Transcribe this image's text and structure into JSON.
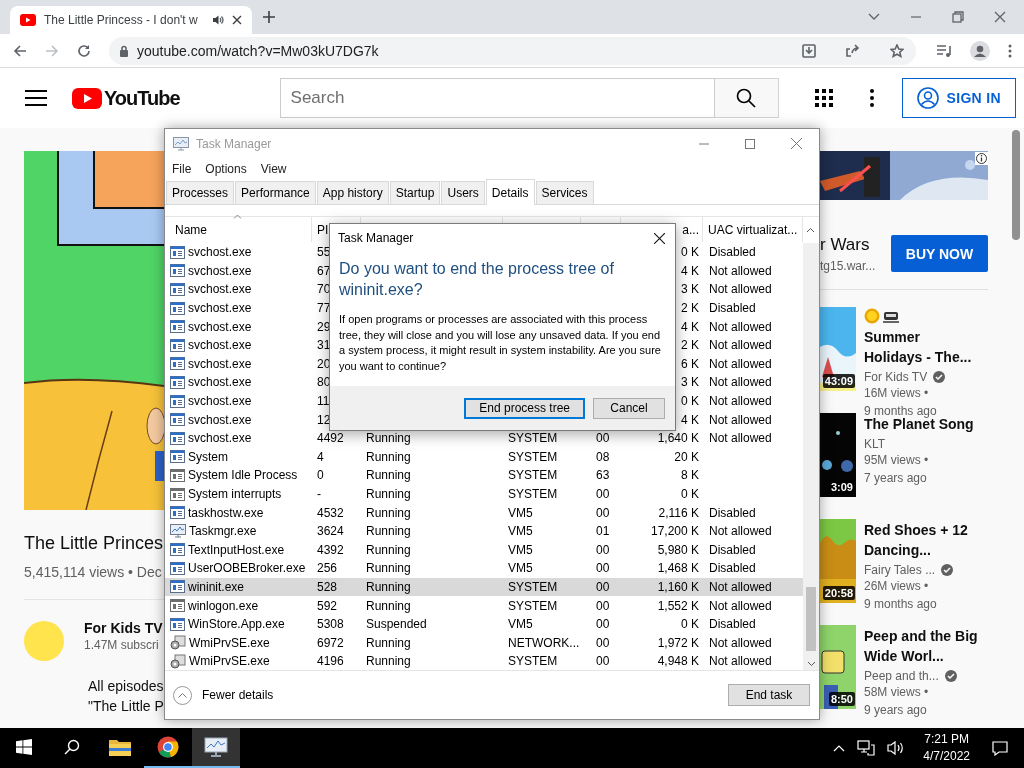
{
  "browser": {
    "tab": {
      "title": "The Little Princess - I don't w",
      "selected": true
    },
    "address": "youtube.com/watch?v=Mw03kU7DG7k"
  },
  "youtube": {
    "logo": "YouTube",
    "search": {
      "placeholder": "Search"
    },
    "sign_in": "SIGN IN",
    "video": {
      "title": "The Little Princes",
      "meta": "5,415,114 views • Dec"
    },
    "channel": {
      "name": "For Kids TV",
      "subscribers": "1.47M subscri"
    },
    "description": [
      "All episodes",
      "\"The Little P"
    ],
    "ad": {
      "title": "r Wars",
      "url": "tg15.war...",
      "button": "BUY NOW"
    },
    "related": [
      {
        "kind": "icon_title",
        "title": "Summer Holidays - The...",
        "channel": "For Kids TV",
        "verified": true,
        "views": "16M views •",
        "age": "9 months ago",
        "duration": "43:09"
      },
      {
        "kind": "plain",
        "title": "The Planet Song",
        "channel": "KLT",
        "verified": false,
        "views": "95M views •",
        "age": "7 years ago",
        "duration": "3:09"
      },
      {
        "kind": "plain",
        "title": "Red Shoes + 12 Dancing...",
        "channel": "Fairy Tales ...",
        "verified": true,
        "views": "26M views •",
        "age": "9 months ago",
        "duration": "20:58"
      },
      {
        "kind": "plain",
        "title": "Peep and the Big Wide Worl...",
        "channel": "Peep and th...",
        "verified": true,
        "views": "58M views •",
        "age": "9 years ago",
        "duration": "8:50"
      }
    ]
  },
  "task_manager": {
    "title": "Task Manager",
    "menu": [
      "File",
      "Options",
      "View"
    ],
    "tabs": [
      {
        "label": "Processes",
        "selected": false
      },
      {
        "label": "Performance",
        "selected": false
      },
      {
        "label": "App history",
        "selected": false
      },
      {
        "label": "Startup",
        "selected": false
      },
      {
        "label": "Users",
        "selected": false
      },
      {
        "label": "Details",
        "selected": true
      },
      {
        "label": "Services",
        "selected": false
      }
    ],
    "columns": {
      "name": "Name",
      "column_2": "PI",
      "column_6": "a...",
      "uac": "UAC virtualizat..."
    },
    "rows": [
      {
        "kind": "window",
        "name": "svchost.exe",
        "pid": "55",
        "memory": "0 K",
        "uac": "Disabled",
        "selected": false
      },
      {
        "kind": "window",
        "name": "svchost.exe",
        "pid": "67",
        "memory": "4 K",
        "uac": "Not allowed",
        "selected": false
      },
      {
        "kind": "window",
        "name": "svchost.exe",
        "pid": "70",
        "memory": "3 K",
        "uac": "Not allowed",
        "selected": false
      },
      {
        "kind": "window",
        "name": "svchost.exe",
        "pid": "77",
        "memory": "2 K",
        "uac": "Disabled",
        "selected": false
      },
      {
        "kind": "window",
        "name": "svchost.exe",
        "pid": "29",
        "memory": "4 K",
        "uac": "Not allowed",
        "selected": false
      },
      {
        "kind": "window",
        "name": "svchost.exe",
        "pid": "31",
        "memory": "2 K",
        "uac": "Not allowed",
        "selected": false
      },
      {
        "kind": "window",
        "name": "svchost.exe",
        "pid": "20",
        "memory": "6 K",
        "uac": "Not allowed",
        "selected": false
      },
      {
        "kind": "window",
        "name": "svchost.exe",
        "pid": "80",
        "memory": "3 K",
        "uac": "Not allowed",
        "selected": false
      },
      {
        "kind": "window",
        "name": "svchost.exe",
        "pid": "11",
        "memory": "0 K",
        "uac": "Not allowed",
        "selected": false
      },
      {
        "kind": "window",
        "name": "svchost.exe",
        "pid": "12",
        "memory": "4 K",
        "uac": "Not allowed",
        "selected": false
      },
      {
        "kind": "window",
        "name": "svchost.exe",
        "pid": "4492",
        "status": "Running",
        "user": "SYSTEM",
        "cpu": "00",
        "memory": "1,640 K",
        "uac": "Not allowed",
        "selected": false
      },
      {
        "kind": "window",
        "name": "System",
        "pid": "4",
        "status": "Running",
        "user": "SYSTEM",
        "cpu": "08",
        "memory": "20 K",
        "selected": false
      },
      {
        "kind": "window-lines",
        "name": "System Idle Process",
        "pid": "0",
        "status": "Running",
        "user": "SYSTEM",
        "cpu": "63",
        "memory": "8 K",
        "selected": false
      },
      {
        "kind": "window-lines",
        "name": "System interrupts",
        "pid": "-",
        "status": "Running",
        "user": "SYSTEM",
        "cpu": "00",
        "memory": "0 K",
        "selected": false
      },
      {
        "kind": "window",
        "name": "taskhostw.exe",
        "pid": "4532",
        "status": "Running",
        "user": "VM5",
        "cpu": "00",
        "memory": "2,116 K",
        "uac": "Disabled",
        "selected": false
      },
      {
        "kind": "monitor",
        "name": "Taskmgr.exe",
        "pid": "3624",
        "status": "Running",
        "user": "VM5",
        "cpu": "01",
        "memory": "17,200 K",
        "uac": "Not allowed",
        "selected": false
      },
      {
        "kind": "window",
        "name": "TextInputHost.exe",
        "pid": "4392",
        "status": "Running",
        "user": "VM5",
        "cpu": "00",
        "memory": "5,980 K",
        "uac": "Disabled",
        "selected": false
      },
      {
        "kind": "window",
        "name": "UserOOBEBroker.exe",
        "pid": "256",
        "status": "Running",
        "user": "VM5",
        "cpu": "00",
        "memory": "1,468 K",
        "uac": "Disabled",
        "selected": false
      },
      {
        "kind": "window",
        "name": "wininit.exe",
        "pid": "528",
        "status": "Running",
        "user": "SYSTEM",
        "cpu": "00",
        "memory": "1,160 K",
        "uac": "Not allowed",
        "selected": true
      },
      {
        "kind": "window-lines",
        "name": "winlogon.exe",
        "pid": "592",
        "status": "Running",
        "user": "SYSTEM",
        "cpu": "00",
        "memory": "1,552 K",
        "uac": "Not allowed",
        "selected": false
      },
      {
        "kind": "window",
        "name": "WinStore.App.exe",
        "pid": "5308",
        "status": "Suspended",
        "user": "VM5",
        "cpu": "00",
        "memory": "0 K",
        "uac": "Disabled",
        "selected": false
      },
      {
        "kind": "gears",
        "name": "WmiPrvSE.exe",
        "pid": "6972",
        "status": "Running",
        "user": "NETWORK...",
        "cpu": "00",
        "memory": "1,972 K",
        "uac": "Not allowed",
        "selected": false
      },
      {
        "kind": "gears",
        "name": "WmiPrvSE.exe",
        "pid": "4196",
        "status": "Running",
        "user": "SYSTEM",
        "cpu": "00",
        "memory": "4,948 K",
        "uac": "Not allowed",
        "selected": false
      }
    ],
    "fewer_details": "Fewer details",
    "end_task": "End task"
  },
  "dialog": {
    "title": "Task Manager",
    "heading": "Do you want to end the process tree of wininit.exe?",
    "message": "If open programs or processes are associated with this process tree, they will close and you will lose any unsaved data. If you end a system process, it might result in system instability. Are you sure you want to continue?",
    "buttons": [
      {
        "label": "End process tree",
        "focused": true
      },
      {
        "label": "Cancel",
        "focused": false
      }
    ]
  },
  "taskbar": {
    "apps": [
      {
        "kind": "start",
        "running": false,
        "active": false
      },
      {
        "kind": "search",
        "running": false,
        "active": false
      },
      {
        "kind": "explorer",
        "running": false,
        "active": false
      },
      {
        "kind": "browser",
        "running": true,
        "active": false
      },
      {
        "kind": "task_manager",
        "running": true,
        "active": true
      }
    ],
    "time": "7:21 PM",
    "date": "4/7/2022"
  }
}
